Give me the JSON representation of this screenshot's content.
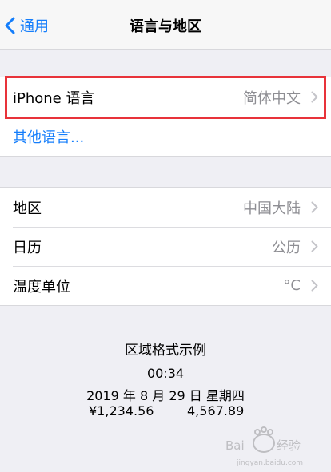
{
  "nav": {
    "back_label": "通用",
    "title": "语言与地区"
  },
  "language_group": {
    "iphone_language_label": "iPhone 语言",
    "iphone_language_value": "简体中文",
    "other_languages_label": "其他语言..."
  },
  "region_group": {
    "rows": [
      {
        "label": "地区",
        "value": "中国大陆"
      },
      {
        "label": "日历",
        "value": "公历"
      },
      {
        "label": "温度单位",
        "value": "°C"
      }
    ]
  },
  "region_format_example": {
    "heading": "区域格式示例",
    "time": "00:34",
    "date": "2019 年 8 月 29 日 星期四",
    "currency": "¥1,234.56",
    "number": "4,567.89"
  },
  "watermark": {
    "text": "Baidu 经验",
    "url": "jingyan.baidu.com"
  },
  "colors": {
    "accent": "#157efb",
    "highlight_border": "#e8333a",
    "background": "#efeff4",
    "secondary_text": "#8e8e93"
  }
}
